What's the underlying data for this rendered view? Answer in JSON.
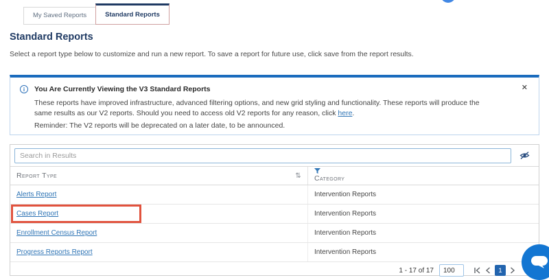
{
  "tabs": {
    "saved": "My Saved Reports",
    "standard": "Standard Reports"
  },
  "page": {
    "title": "Standard Reports",
    "subtitle": "Select a report type below to customize and run a new report. To save a report for future use, click save from the report results."
  },
  "banner": {
    "title": "You Are Currently Viewing the V3 Standard Reports",
    "body_start": "These reports have improved infrastructure, advanced filtering options, and new grid styling and functionality. These reports will produce the same results as our V2 reports. Should you need to access old V2 reports for any reason, click ",
    "link": "here",
    "body_end": ".",
    "reminder": "Reminder: The V2 reports will be deprecated on a later date, to be announced.",
    "close": "✕"
  },
  "search": {
    "placeholder": "Search in Results"
  },
  "table": {
    "headers": {
      "report_type": "Report Type",
      "category": "Category"
    },
    "rows": [
      {
        "report_type": "Alerts Report",
        "category": "Intervention Reports",
        "highlighted": false
      },
      {
        "report_type": "Cases Report",
        "category": "Intervention Reports",
        "highlighted": true
      },
      {
        "report_type": "Enrollment Census Report",
        "category": "Intervention Reports",
        "highlighted": false
      },
      {
        "report_type": "Progress Reports Report",
        "category": "Intervention Reports",
        "highlighted": false
      }
    ]
  },
  "pagination": {
    "range": "1 - 17 of 17",
    "page_size": "100",
    "current": "1"
  },
  "colors": {
    "navy": "#1f3a63",
    "link_blue": "#2e74b5",
    "banner_top_blue": "#1a6bbd",
    "highlight_red": "#e1523d",
    "chat_blue": "#1376d2",
    "active_page_blue": "#2264ae"
  }
}
